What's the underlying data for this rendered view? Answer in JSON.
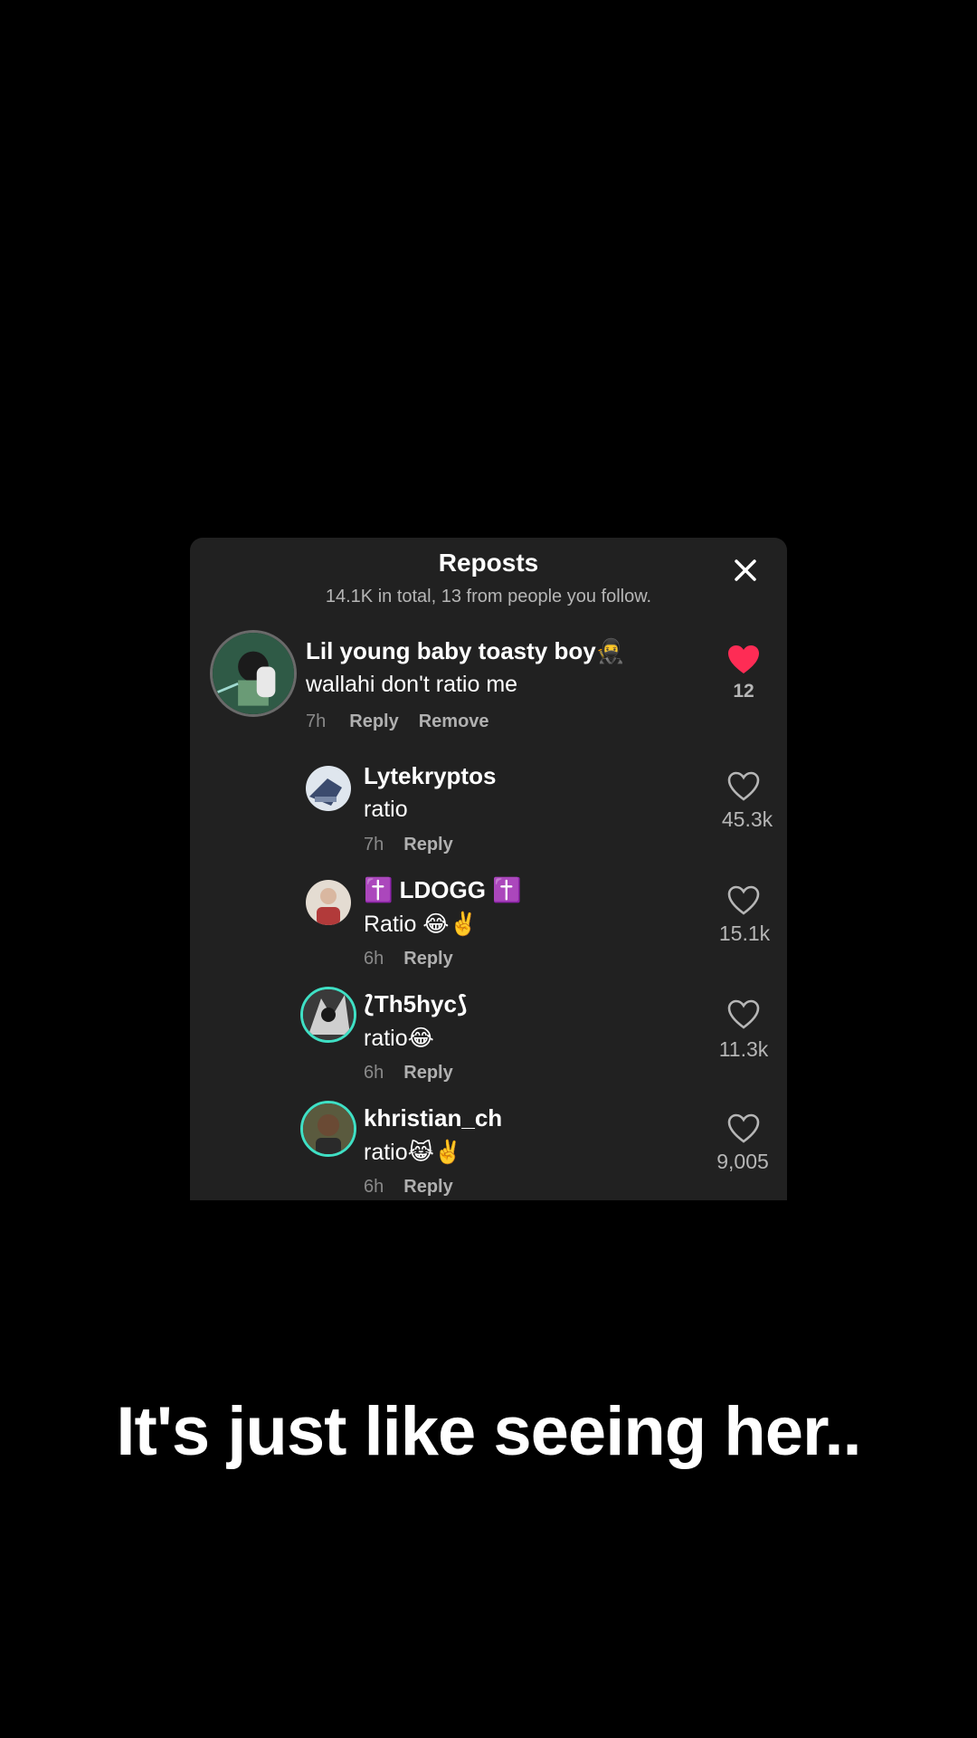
{
  "panel": {
    "title": "Reposts",
    "subtitle": "14.1K in total, 13 from people you follow."
  },
  "main_comment": {
    "username": "Lil young baby toasty boy🥷",
    "text": "wallahi don't ratio me",
    "time": "7h",
    "reply_label": "Reply",
    "remove_label": "Remove",
    "likes": "12",
    "liked": true,
    "like_color": "#fe2c55"
  },
  "replies": [
    {
      "username": "Lytekryptos",
      "text": "ratio",
      "time": "7h",
      "reply_label": "Reply",
      "likes": "45.3k"
    },
    {
      "username": "✝️ LDOGG ✝️",
      "text": "Ratio 😂✌️",
      "time": "6h",
      "reply_label": "Reply",
      "likes": "15.1k"
    },
    {
      "username": "⟅Th5hyc⟆",
      "text": "ratio😂",
      "time": "6h",
      "reply_label": "Reply",
      "likes": "11.3k"
    },
    {
      "username": "khristian_ch",
      "text": "ratio😹✌️",
      "time": "6h",
      "reply_label": "Reply",
      "likes": "9,005"
    }
  ],
  "caption": "It's just like seeing her..",
  "icons": {
    "close": "close-icon",
    "heart": "heart-icon"
  }
}
